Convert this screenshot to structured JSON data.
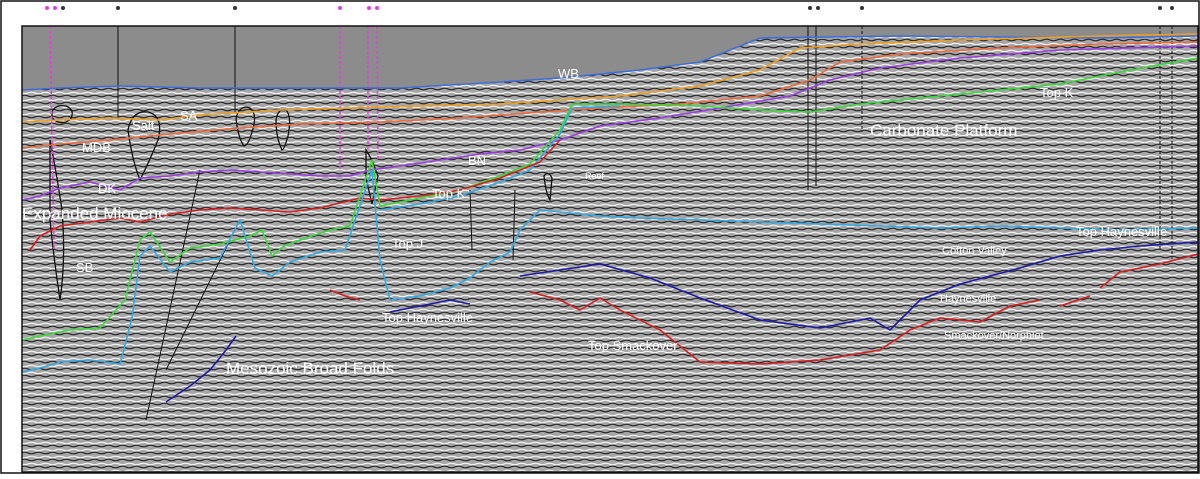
{
  "section": {
    "labels": {
      "wb": "WB",
      "sa": "SA",
      "salt": "Salt",
      "mdb": "MDB",
      "dk": "DK",
      "expanded_miocene": "Expanded Miocene",
      "sb": "SB",
      "bn": "BN",
      "top_k_left": "Top K",
      "top_k_right": "Top K",
      "top_j": "Top J",
      "reef": "Reef",
      "carbonate_platform": "Carbonate Platform",
      "top_haynesville_left": "Top Haynesville",
      "top_haynesville_right": "Top Haynesville",
      "cotton_valley": "Cotton Valley",
      "haynesville": "Haynesville",
      "smackover_norphlet": "Smackover/Norphlet",
      "top_smackover": "Top Smackover",
      "mesozoic_broad_folds": "Mesozoic Broad Folds"
    },
    "colors": {
      "water_column": "#8c8c8c",
      "seismic_background": "#a6a6a6",
      "wb": "#3f6fd6",
      "sa": "#f0a020",
      "mdb": "#ec6a3c",
      "dk": "#9a3fe0",
      "green_horizon": "#3bd83b",
      "cyan_horizon": "#34a8e0",
      "red_horizon": "#d42020",
      "blue_horizon": "#1c1ca8",
      "salt_outline": "#111111",
      "well_track": "#e040e0",
      "fault": "#111111"
    }
  }
}
